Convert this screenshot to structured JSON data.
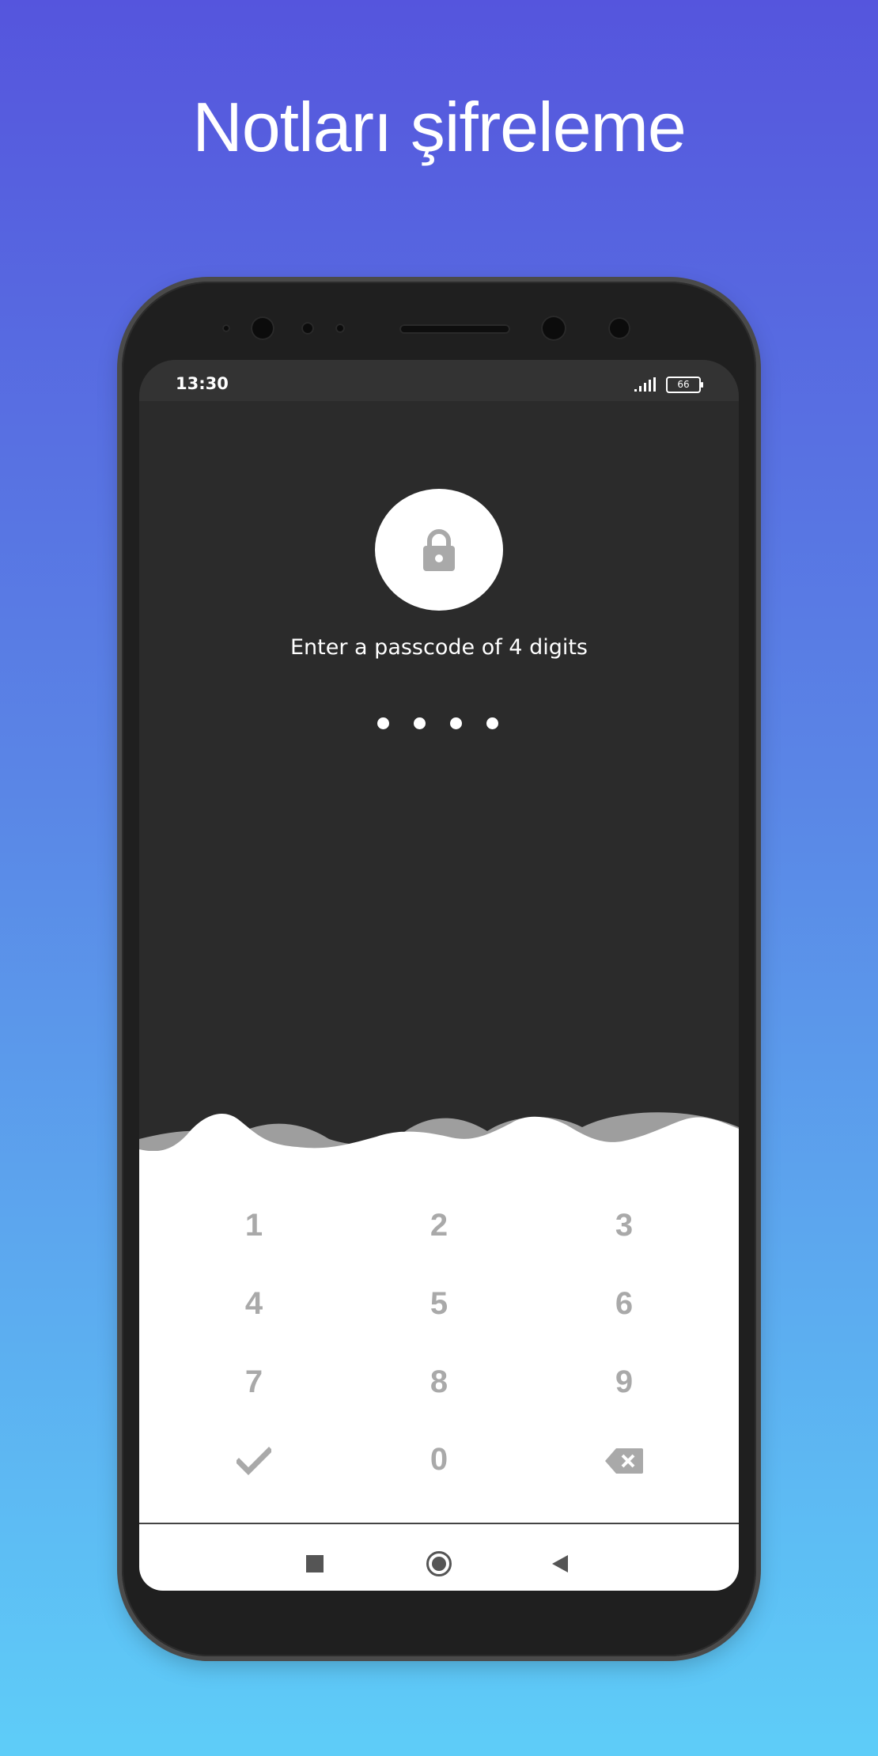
{
  "headline": "Notları şifreleme",
  "status_bar": {
    "time": "13:30",
    "battery_level": "66",
    "signal_icon": "signal-bars-icon"
  },
  "lock_screen": {
    "lock_icon": "lock-icon",
    "prompt": "Enter a passcode of 4 digits",
    "entered_digits": 4,
    "passcode_length": 4
  },
  "keypad": {
    "keys": [
      "1",
      "2",
      "3",
      "4",
      "5",
      "6",
      "7",
      "8",
      "9",
      "",
      "0",
      ""
    ],
    "confirm_icon": "check-icon",
    "delete_icon": "backspace-icon"
  },
  "nav_bar": {
    "recents_icon": "recents-square-icon",
    "home_icon": "home-circle-icon",
    "back_icon": "back-triangle-icon"
  },
  "colors": {
    "background_top": "#5555dd",
    "background_bottom": "#5ecdf8",
    "screen_dark": "#2b2b2b",
    "key_text": "#a9a9a9"
  }
}
